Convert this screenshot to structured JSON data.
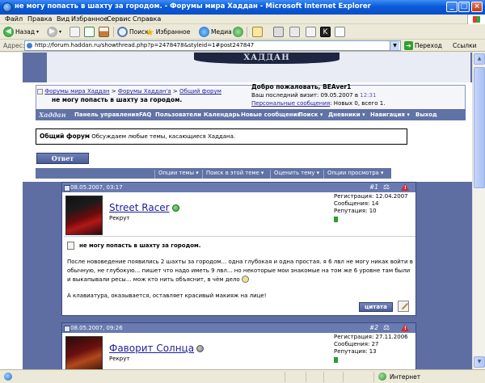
{
  "window": {
    "title": "не могу попасть в шахту за городом. - Форумы мира Хаддан - Microsoft Internet Explorer",
    "buttons": [
      "_",
      "□",
      "×"
    ]
  },
  "menu": [
    "Файл",
    "Правка",
    "Вид",
    "Избранное",
    "Сервис",
    "Справка"
  ],
  "toolbar": {
    "back": "Назад",
    "search": "Поиск",
    "favorites": "Избранное",
    "media": "Медиа"
  },
  "address": {
    "label": "Адрес:",
    "url": "http://forum.haddan.ru/showthread.php?p=2478478&styleid=1#post247847",
    "go": "Переход",
    "links": "Ссылки"
  },
  "forum": {
    "logo_text": "ХАДДАН",
    "breadcrumb": [
      "Форумы мира Хаддан",
      "Форумы Хаддан'а",
      "Общий форум"
    ],
    "thread_title": "не могу попасть в шахту за городом.",
    "user": {
      "welcome": "Добро пожаловать, BEAver1",
      "last_visit_prefix": "Ваш последний визит: 09.05.2007 в",
      "last_visit_time": "12:31",
      "pm_link": "Персональные сообщения",
      "pm_counts": ": Новых 0, всего 1."
    },
    "nav": {
      "logo": "Хаддан",
      "items": [
        "Панель управления",
        "FAQ",
        "Пользователи",
        "Календарь",
        "Новые сообщения",
        "Поиск ▾",
        "Дневники ▾",
        "Навигация ▾",
        "Выход"
      ]
    },
    "forum_box": {
      "name": "Общий форум",
      "description": "Обсуждаем любые темы, касающиеся Хаддана."
    },
    "reply_button": "Ответ",
    "thread_tools": [
      "Опции темы ▾",
      "Поиск в этой теме ▾",
      "Оценить тему ▾",
      "Опции просмотра ▾"
    ]
  },
  "posts": [
    {
      "date": "08.05.2007, 03:17",
      "number": "#1",
      "username": "Street Racer",
      "online": true,
      "rank": "Рекрут",
      "stats": [
        "Регистрация: 12.04.2007",
        "Сообщения: 14",
        "Репутация: 10"
      ],
      "title": "не могу попасть в шахту за городом.",
      "body": "После нововедение появились 2 шахты за городом... одна глубокая и одна простая. я 6 лвл не могу никак войти в обычную, не глубокую... пишет что надо иметь 9 лвл... но некоторые мои знакомые на том же 6 уровне там были и выкапывали ресы... мож кто нить объяснит, в чём дело",
      "signature": "А клавиатура, оказывается, оставляет красивый макияж на лице!",
      "quote_button": "цитата"
    },
    {
      "date": "08.05.2007, 09:26",
      "number": "#2",
      "username": "Фаворит Солнца",
      "online": false,
      "rank": "Рекрут",
      "stats": [
        "Регистрация: 27.11.2006",
        "Сообщения: 27",
        "Репутация: 13"
      ]
    }
  ],
  "status": {
    "zone": "Интернет"
  },
  "colors": {
    "nav_bg": "#6172a5",
    "post_header_bg": "#6a7bb1",
    "link": "#22229c",
    "online": "#2b9b2b"
  }
}
